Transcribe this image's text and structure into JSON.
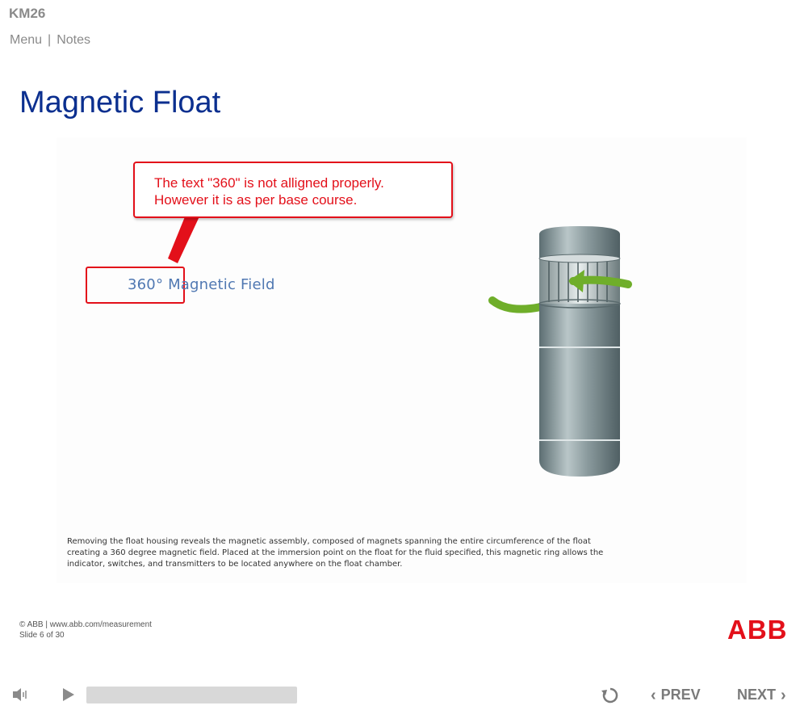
{
  "app": {
    "course_code": "KM26",
    "nav": {
      "menu": "Menu",
      "separator": "|",
      "notes": "Notes"
    }
  },
  "slide": {
    "title": "Magnetic Float",
    "callout": {
      "line1": "The text \"360\" is not alligned properly.",
      "line2": "However it is as per base course."
    },
    "figure_label": "360° Magnetic Field",
    "caption_lines": [
      "Removing the float housing reveals the magnetic assembly, composed of magnets spanning the entire circumference of the float",
      "creating a 360 degree magnetic field.  Placed at the immersion point on the float for the fluid specified, this magnetic ring allows the",
      "indicator, switches, and transmitters to be located anywhere on the float chamber."
    ]
  },
  "footer": {
    "copyright": "© ABB | www.abb.com/measurement",
    "slide_counter": "Slide 6 of 30",
    "logo_text": "ABB"
  },
  "player": {
    "progress": 0,
    "prev_label": "PREV",
    "next_label": "NEXT",
    "icons": [
      "volume-icon",
      "play-icon",
      "replay-icon",
      "chevron-left-icon",
      "chevron-right-icon"
    ]
  },
  "colors": {
    "title": "#0b2f8f",
    "callout": "#e3101a",
    "brand": "#e3101a",
    "figure_label": "#5078b2"
  }
}
